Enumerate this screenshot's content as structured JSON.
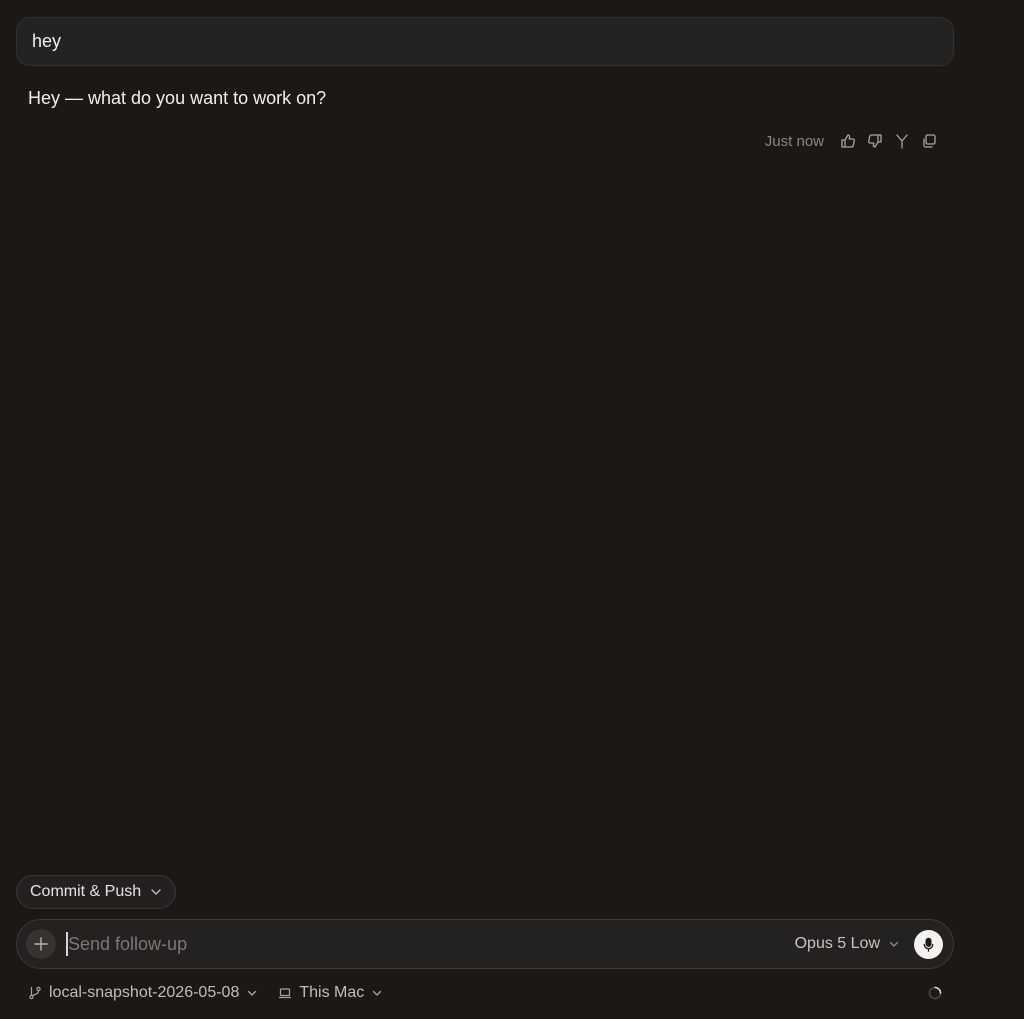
{
  "conversation": {
    "user_message": "hey",
    "assistant_message": "Hey — what do you want to work on?",
    "timestamp": "Just now",
    "actions": [
      {
        "icon": "thumbs-up-icon"
      },
      {
        "icon": "thumbs-down-icon"
      },
      {
        "icon": "fork-icon"
      },
      {
        "icon": "copy-icon"
      }
    ]
  },
  "commit": {
    "label": "Commit & Push"
  },
  "composer": {
    "placeholder": "Send follow-up",
    "model_label": "Opus 5 Low"
  },
  "footer": {
    "branch": "local-snapshot-2026-05-08",
    "environment": "This Mac"
  }
}
